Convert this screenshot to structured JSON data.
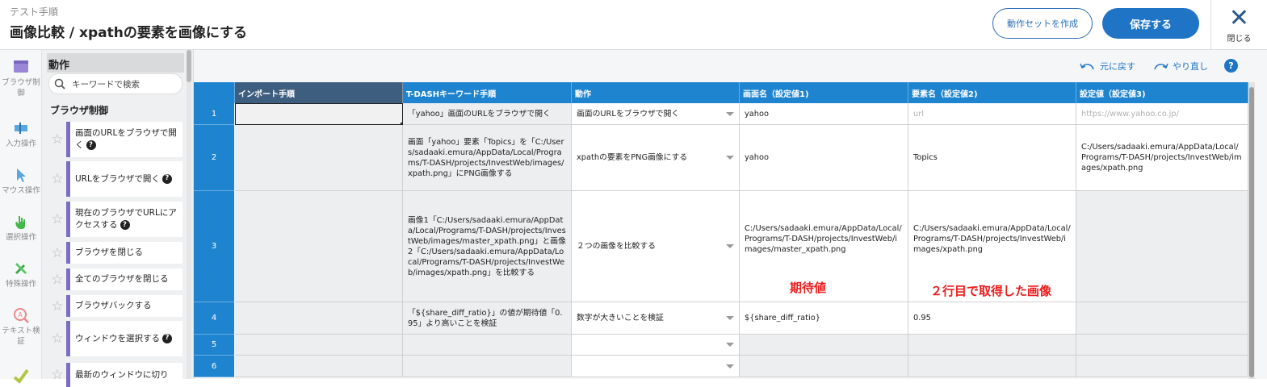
{
  "header": {
    "subtitle": "テスト手順",
    "title": "画像比較 / xpathの要素を画像にする",
    "create_set_label": "動作セットを作成",
    "save_label": "保存する",
    "close_label": "閉じる"
  },
  "leftnav": [
    {
      "label": "ブラウザ制御",
      "icon": "browser-icon"
    },
    {
      "label": "入力操作",
      "icon": "input-icon"
    },
    {
      "label": "マウス操作",
      "icon": "cursor-icon"
    },
    {
      "label": "選択操作",
      "icon": "hand-icon"
    },
    {
      "label": "特殊操作",
      "icon": "tools-icon"
    },
    {
      "label": "テキスト検証",
      "icon": "text-verify-icon"
    },
    {
      "label": "",
      "icon": "verify-icon"
    }
  ],
  "actions": {
    "heading": "動作",
    "search_placeholder": "キーワードで検索",
    "category": "ブラウザ制御",
    "items": [
      {
        "label": "画面のURLをブラウザで開く",
        "help": true
      },
      {
        "label": "URLをブラウザで開く",
        "help": true
      },
      {
        "label": "現在のブラウザでURLにアクセスする",
        "help": true
      },
      {
        "label": "ブラウザを閉じる",
        "help": false
      },
      {
        "label": "全てのブラウザを閉じる",
        "help": false
      },
      {
        "label": "ブラウザバックする",
        "help": false
      },
      {
        "label": "ウィンドウを選択する",
        "help": true
      },
      {
        "label": "最新のウィンドウに切り",
        "help": false
      }
    ]
  },
  "toolbar": {
    "undo_label": "元に戻す",
    "redo_label": "やり直し",
    "help": "?"
  },
  "table": {
    "headers": [
      "インポート手順",
      "T-DASHキーワード手順",
      "動作",
      "画面名（設定値1)",
      "要素名（設定値2)",
      "設定値（設定値3)"
    ],
    "rows": [
      {
        "num": "1",
        "import": "",
        "keyword": "「yahoo」画面のURLをブラウザで開く",
        "action": "画面のURLをブラウザで開く",
        "v1": "yahoo",
        "v2": "url",
        "v3": "https://www.yahoo.co.jp/"
      },
      {
        "num": "2",
        "import": "",
        "keyword": "画面「yahoo」要素「Topics」を「C:/Users/sadaaki.emura/AppData/Local/Programs/T-DASH/projects/InvestWeb/images/xpath.png」にPNG画像する",
        "action": "xpathの要素をPNG画像にする",
        "v1": "yahoo",
        "v2": "Topics",
        "v3": "C:/Users/sadaaki.emura/AppData/Local/Programs/T-DASH/projects/InvestWeb/images/xpath.png"
      },
      {
        "num": "3",
        "import": "",
        "keyword": "画像1「C:/Users/sadaaki.emura/AppData/Local/Programs/T-DASH/projects/InvestWeb/images/master_xpath.png」と画像2「C:/Users/sadaaki.emura/AppData/Local/Programs/T-DASH/projects/InvestWeb/images/xpath.png」を比較する",
        "action": "２つの画像を比較する",
        "v1": "C:/Users/sadaaki.emura/AppData/Local/Programs/T-DASH/projects/InvestWeb/images/master_xpath.png",
        "v2": "C:/Users/sadaaki.emura/AppData/Local/Programs/T-DASH/projects/InvestWeb/images/xpath.png",
        "v3": ""
      },
      {
        "num": "4",
        "import": "",
        "keyword": "「${share_diff_ratio}」の値が期待値「0.95」より高いことを検証",
        "action": "数字が大きいことを検証",
        "v1": "${share_diff_ratio}",
        "v2": "0.95",
        "v3": ""
      },
      {
        "num": "5",
        "import": "",
        "keyword": "",
        "action": "",
        "v1": "",
        "v2": "",
        "v3": ""
      },
      {
        "num": "6",
        "import": "",
        "keyword": "",
        "action": "",
        "v1": "",
        "v2": "",
        "v3": ""
      }
    ]
  },
  "annotations": {
    "expected": "期待値",
    "row2_image": "２行目で取得した画像"
  },
  "colors": {
    "accent": "#1f74c6",
    "header_blue": "#1f84d0",
    "header_dark": "#3e5e80",
    "annotation_red": "#ee1c1c"
  }
}
